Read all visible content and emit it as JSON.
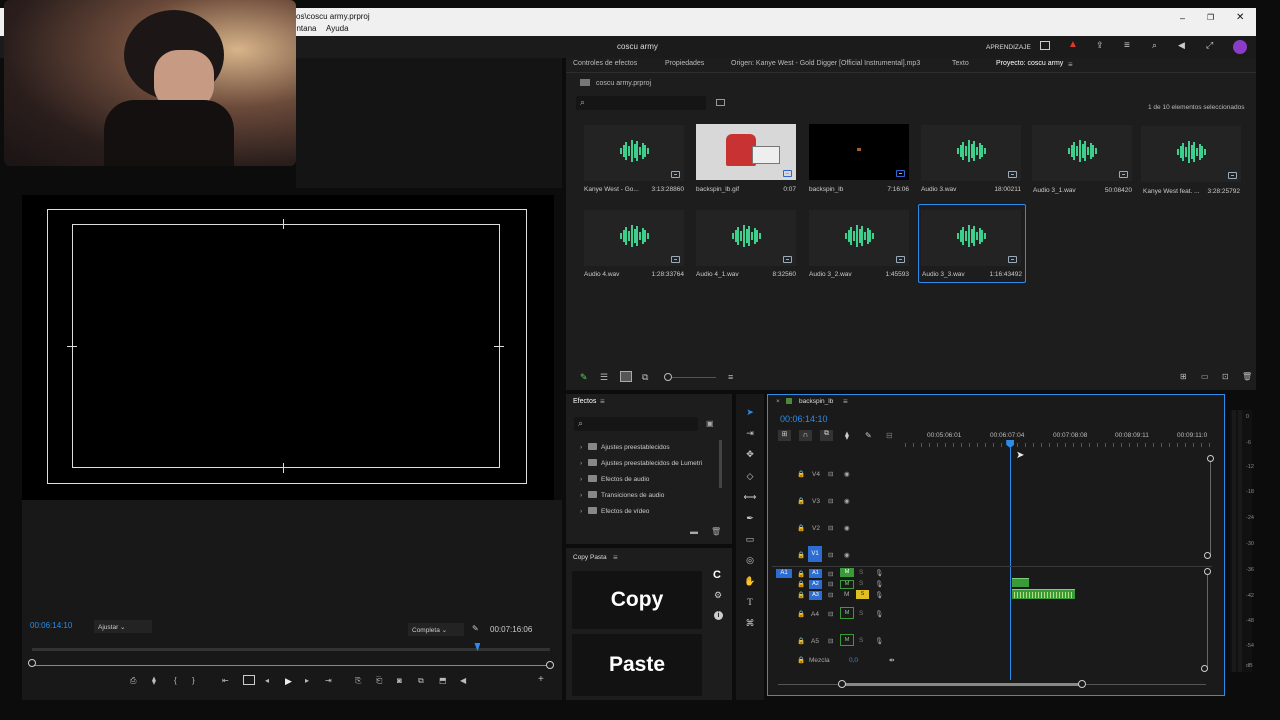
{
  "window": {
    "title_path": "vos\\coscu army.prproj",
    "menu_items": [
      "entana",
      "Ayuda"
    ],
    "controls": [
      "–",
      "❐",
      "✕"
    ]
  },
  "app": {
    "project_title": "coscu army",
    "learn_label": "APRENDIZAJE"
  },
  "source_panel": {
    "tabs": [
      "Controles de efectos",
      "Propiedades",
      "Origen: Kanye West - Gold Digger [Official Instrumental].mp3",
      "Texto",
      "Proyecto: coscu army"
    ],
    "project_file": "coscu army.prproj",
    "search_placeholder": "",
    "selection_count": "1 de 10 elementos seleccionados",
    "items": [
      {
        "name": "Kanye West - Go...",
        "duration": "3:13:28860",
        "type": "audio"
      },
      {
        "name": "backspin_lb.gif",
        "duration": "0:07",
        "type": "image"
      },
      {
        "name": "backspin_lb",
        "duration": "7:16:06",
        "type": "sequence"
      },
      {
        "name": "Audio 3.wav",
        "duration": "18:00211",
        "type": "audio"
      },
      {
        "name": "Audio 3_1.wav",
        "duration": "50:08420",
        "type": "audio"
      },
      {
        "name": "Kanye West feat. ...",
        "duration": "3:28:25792",
        "type": "audio"
      },
      {
        "name": "Audio 4.wav",
        "duration": "1:28:33764",
        "type": "audio"
      },
      {
        "name": "Audio 4_1.wav",
        "duration": "8:32560",
        "type": "audio"
      },
      {
        "name": "Audio 3_2.wav",
        "duration": "1:45593",
        "type": "audio"
      },
      {
        "name": "Audio 3_3.wav",
        "duration": "1:16:43492",
        "type": "audio",
        "selected": true
      }
    ]
  },
  "program_monitor": {
    "timecode": "00:06:14:10",
    "fit_label": "Ajustar",
    "quality_label": "Completa",
    "duration": "00:07:16:06",
    "playhead_fraction": 0.86
  },
  "effects_panel": {
    "title": "Efectos",
    "items": [
      "Ajustes preestablecidos",
      "Ajustes preestablecidos de Lumetri",
      "Efectos de audio",
      "Transiciones de audio",
      "Efectos de vídeo"
    ]
  },
  "copy_paste_panel": {
    "title": "Copy Pasta",
    "copy_label": "Copy",
    "paste_label": "Paste",
    "logo_letter": "C"
  },
  "timeline": {
    "sequence_name": "backspin_lb",
    "timecode": "00:06:14:10",
    "ruler_labels": [
      "00:05:06:01",
      "00:06:07:04",
      "00:07:08:08",
      "00:08:09:11",
      "00:09:11:0"
    ],
    "video_tracks": [
      "V4",
      "V3",
      "V2",
      "V1"
    ],
    "audio_tracks": [
      "A1",
      "A2",
      "A3",
      "A4",
      "A5"
    ],
    "source_patch_audio": "A1",
    "mix_label": "Mezcla",
    "mix_value": "0,0",
    "m_label": "M",
    "s_label": "S",
    "playhead_fraction": 0.345
  },
  "meter_scale": [
    "0",
    "-6",
    "-12",
    "-18",
    "-24",
    "-30",
    "-36",
    "-42",
    "-48",
    "-54",
    "dB"
  ],
  "colors": {
    "accent_blue": "#2d8ceb",
    "wave_green": "#3ecf8e",
    "clip_green": "#3a9a3a",
    "solo_yellow": "#e0c020"
  }
}
